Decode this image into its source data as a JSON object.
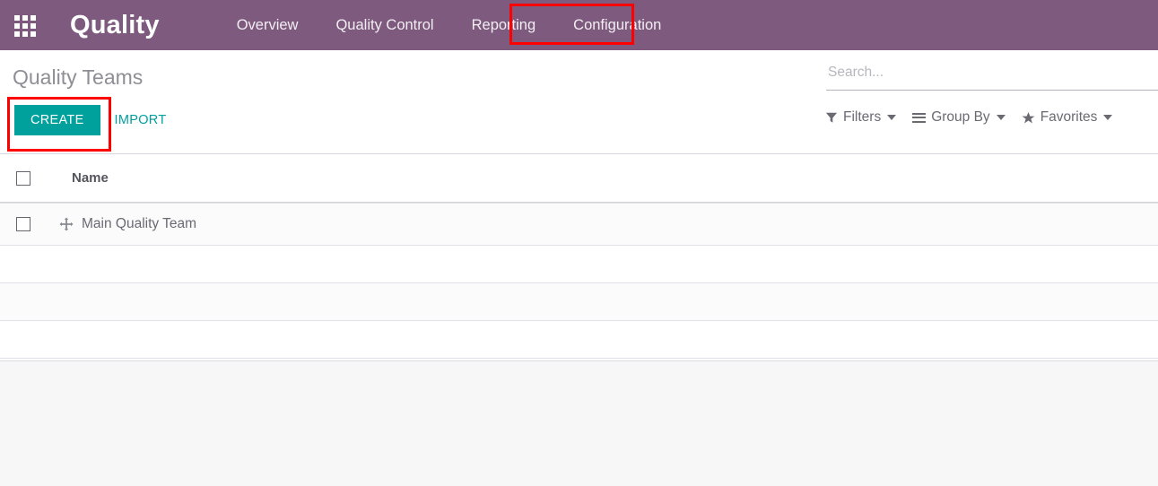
{
  "navbar": {
    "apps_icon": "apps-grid-icon",
    "brand": "Quality",
    "menu": [
      {
        "label": "Overview"
      },
      {
        "label": "Quality Control"
      },
      {
        "label": "Reporting"
      },
      {
        "label": "Configuration"
      }
    ],
    "background_color": "#7e5a7e",
    "highlight_color": "#fe0000"
  },
  "control_panel": {
    "page_title": "Quality Teams",
    "create_label": "CREATE",
    "import_label": "IMPORT",
    "create_color": "#00a09d",
    "search": {
      "placeholder": "Search...",
      "value": "",
      "icon": "search-icon"
    },
    "filters": [
      {
        "label": "Filters",
        "icon": "funnel-icon"
      },
      {
        "label": "Group By",
        "icon": "hamburger-icon"
      },
      {
        "label": "Favorites",
        "icon": "star-icon"
      }
    ]
  },
  "list": {
    "columns": [
      "Name"
    ],
    "rows": [
      {
        "name": "Main Quality Team",
        "handle_icon": "move-arrows-icon"
      }
    ],
    "empty_row_count": 3
  }
}
